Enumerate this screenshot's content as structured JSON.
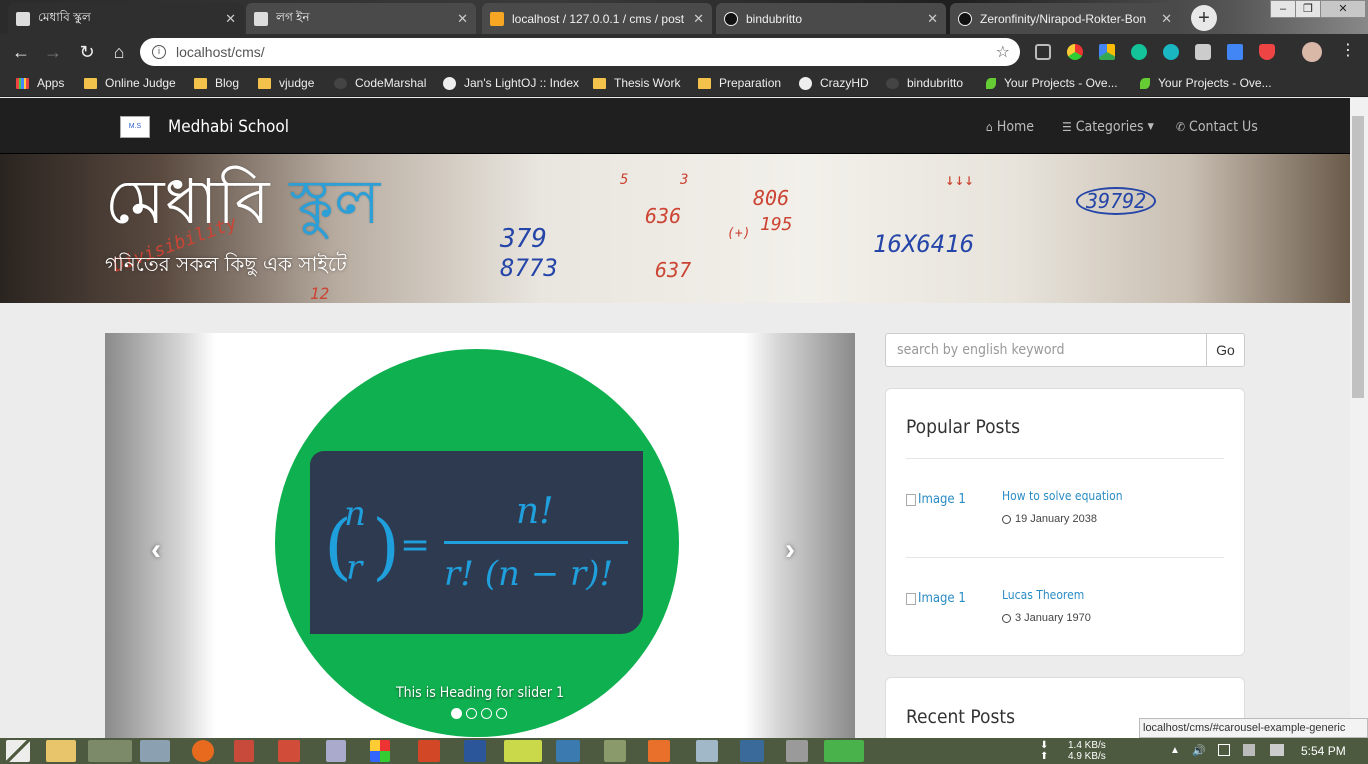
{
  "browser": {
    "tabs": [
      {
        "title": "মেধাবি স্কুল",
        "active": true
      },
      {
        "title": "লগ ইন",
        "active": false
      },
      {
        "title": "localhost / 127.0.0.1 / cms / post",
        "active": false
      },
      {
        "title": "bindubritto",
        "active": false
      },
      {
        "title": "Zeronfinity/Nirapod-Rokter-Bon",
        "active": false
      }
    ],
    "url": "localhost/cms/",
    "bookmarks": [
      {
        "label": "Apps",
        "icon": "apps-icon"
      },
      {
        "label": "Online Judge",
        "icon": "folder-icon"
      },
      {
        "label": "Blog",
        "icon": "folder-icon"
      },
      {
        "label": "vjudge",
        "icon": "folder-icon"
      },
      {
        "label": "CodeMarshal",
        "icon": "codemarshal-icon"
      },
      {
        "label": "Jan's LightOJ :: Index",
        "icon": "globe-icon"
      },
      {
        "label": "Thesis Work",
        "icon": "folder-icon"
      },
      {
        "label": "Preparation",
        "icon": "folder-icon"
      },
      {
        "label": "CrazyHD",
        "icon": "globe-icon"
      },
      {
        "label": "bindubritto",
        "icon": "github-icon"
      },
      {
        "label": "Your Projects - Ove...",
        "icon": "leaf-icon"
      },
      {
        "label": "Your Projects - Ove...",
        "icon": "leaf-icon"
      }
    ],
    "status_url": "localhost/cms/#carousel-example-generic"
  },
  "site": {
    "brand": "Medhabi School",
    "logo_text": "M.S",
    "nav": {
      "home": "Home",
      "categories": "Categories",
      "contact": "Contact Us"
    },
    "hero": {
      "title_part1": "মেধাবি",
      "title_part2": "স্কুল",
      "subtitle": "গনিতের সকল কিছু এক সাইটে"
    },
    "carousel": {
      "caption": "This is Heading for slider 1",
      "formula_lhs_top": "n",
      "formula_lhs_bottom": "r",
      "formula_rhs_num": "n!",
      "formula_rhs_den": "r! (n − r)!",
      "slide_count": 4,
      "active_slide": 1
    },
    "search": {
      "placeholder": "search by english keyword",
      "button": "Go"
    },
    "popular_posts": {
      "heading": "Popular Posts",
      "items": [
        {
          "image_alt": "Image 1",
          "title": "How to solve equation",
          "date": "19 January 2038"
        },
        {
          "image_alt": "Image 1",
          "title": "Lucas Theorem",
          "date": "3 January 1970"
        }
      ]
    },
    "recent_posts": {
      "heading": "Recent Posts"
    },
    "hero_scribbles": [
      "379",
      "8773",
      "636",
      "637",
      "806",
      "195",
      "(+)",
      "39792",
      "16X6416",
      "Divisibility",
      "12",
      "5",
      "3",
      "↓↓↓"
    ]
  },
  "taskbar": {
    "net_down": "1.4 KB/s",
    "net_up": "4.9 KB/s",
    "clock": "5:54 PM"
  },
  "colors": {
    "accent": "#2c9fd6",
    "navbar": "#1f1f1f",
    "slide_circle": "#0fb04f",
    "formula_box": "#2e3a50",
    "link": "#2a8cc4"
  }
}
